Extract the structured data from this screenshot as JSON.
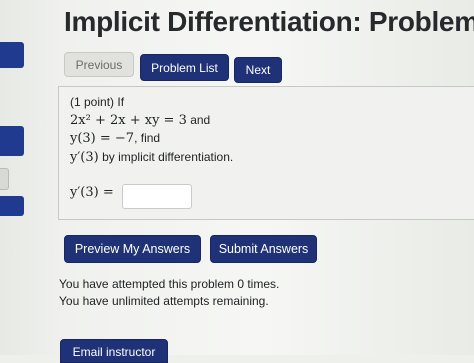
{
  "header": {
    "title": "Implicit Differentiation: Problem"
  },
  "nav": {
    "previous_label": "Previous",
    "problem_list_label": "Problem List",
    "next_label": "Next"
  },
  "problem": {
    "intro": "(1 point) If",
    "equation": "2x² + 2x + xy = 3",
    "and_text": "and",
    "condition": "y(3) = −7",
    "find_text": ", find",
    "target": "y′(3)",
    "by_text": "by implicit differentiation.",
    "answer_label": "y′(3) =",
    "answer_value": ""
  },
  "actions": {
    "preview_label": "Preview My Answers",
    "submit_label": "Submit Answers"
  },
  "status": {
    "attempts": "You have attempted this problem 0 times.",
    "remaining": "You have unlimited attempts remaining."
  },
  "footer": {
    "email_label": "Email instructor"
  },
  "colors": {
    "primary_button": "#1f3277",
    "disabled_button": "#e1e2de",
    "sidebar_accent": "#203a8f"
  }
}
